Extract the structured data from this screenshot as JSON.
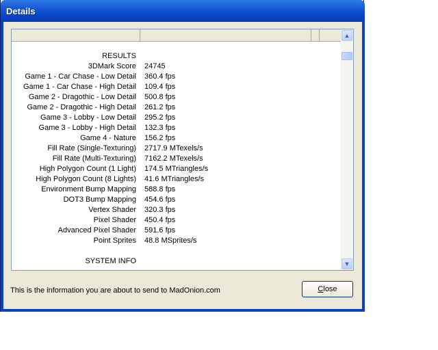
{
  "window": {
    "title": "Details"
  },
  "results": [
    {
      "label": "RESULTS",
      "value": ""
    },
    {
      "label": "3DMark Score",
      "value": "24745"
    },
    {
      "label": "Game 1 - Car Chase - Low Detail",
      "value": "360.4 fps"
    },
    {
      "label": "Game 1 - Car Chase - High Detail",
      "value": "109.4 fps"
    },
    {
      "label": "Game 2 - Dragothic - Low Detail",
      "value": "500.8 fps"
    },
    {
      "label": "Game 2 - Dragothic - High Detail",
      "value": "261.2 fps"
    },
    {
      "label": "Game 3 - Lobby - Low Detail",
      "value": "295.2 fps"
    },
    {
      "label": "Game 3 - Lobby - High Detail",
      "value": "132.3 fps"
    },
    {
      "label": "Game 4 - Nature",
      "value": "156.2 fps"
    },
    {
      "label": "Fill Rate (Single-Texturing)",
      "value": "2717.9 MTexels/s"
    },
    {
      "label": "Fill Rate (Multi-Texturing)",
      "value": "7162.2 MTexels/s"
    },
    {
      "label": "High Polygon Count (1 Light)",
      "value": "174.5 MTriangles/s"
    },
    {
      "label": "High Polygon Count (8 Lights)",
      "value": "41.6 MTriangles/s"
    },
    {
      "label": "Environment Bump Mapping",
      "value": "588.8 fps"
    },
    {
      "label": "DOT3 Bump Mapping",
      "value": "454.6 fps"
    },
    {
      "label": "Vertex Shader",
      "value": "320.3 fps"
    },
    {
      "label": "Pixel Shader",
      "value": "450.4 fps"
    },
    {
      "label": "Advanced Pixel Shader",
      "value": "591.6 fps"
    },
    {
      "label": "Point Sprites",
      "value": "48.8 MSprites/s"
    },
    {
      "label": "",
      "value": ""
    },
    {
      "label": "SYSTEM INFO",
      "value": ""
    }
  ],
  "footer": {
    "info_text": "This is the information you are about to send to MadOnion.com",
    "close_prefix": "",
    "close_mnemonic": "C",
    "close_rest": "lose"
  }
}
